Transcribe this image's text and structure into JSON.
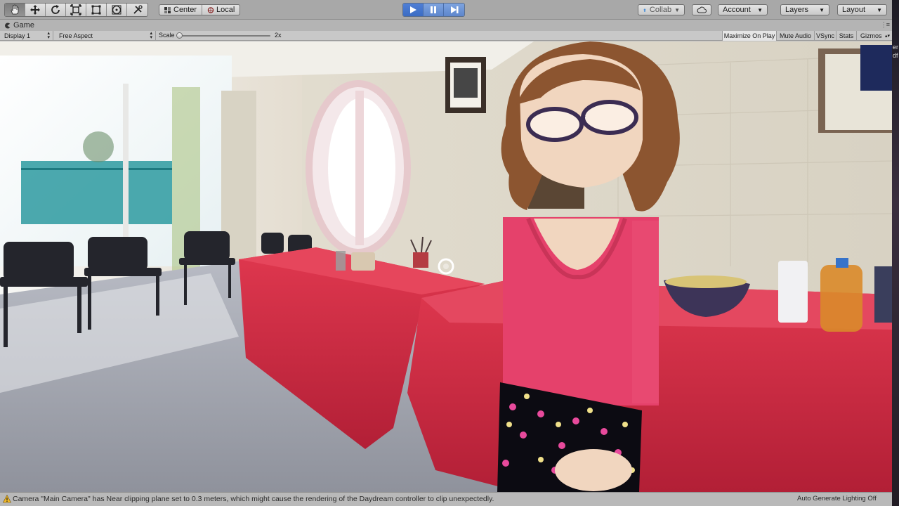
{
  "toolbar": {
    "transform_tools": [
      "hand-tool",
      "move-tool",
      "rotate-tool",
      "scale-tool",
      "rect-tool",
      "transform-tool",
      "custom-tool"
    ],
    "pivot_center": "Center",
    "pivot_local": "Local",
    "collab": "Collab",
    "account": "Account",
    "layers": "Layers",
    "layout": "Layout"
  },
  "game_tab": {
    "label": "Game"
  },
  "game_bar": {
    "display": "Display 1",
    "aspect": "Free Aspect",
    "scale_label": "Scale",
    "scale_value": "2x",
    "scale_fraction": 0.0,
    "maximize_on_play": "Maximize On Play",
    "mute_audio": "Mute Audio",
    "vsync": "VSync",
    "stats": "Stats",
    "gizmos": "Gizmos"
  },
  "status": {
    "warning": "Camera \"Main Camera\" has Near clipping plane set to 0.3 meters, which might cause the rendering of the Daydream controller to clip unexpectedly.",
    "lighting": "Auto Generate Lighting Off"
  },
  "colors": {
    "play_accent": "#3b6cc4",
    "toolbar_bg": "#a8a8a8",
    "tablecloth": "#d6304a",
    "avatar_top": "#e5416b",
    "avatar_hair": "#8c5530"
  },
  "right_edge_text": [
    "er",
    "df"
  ]
}
